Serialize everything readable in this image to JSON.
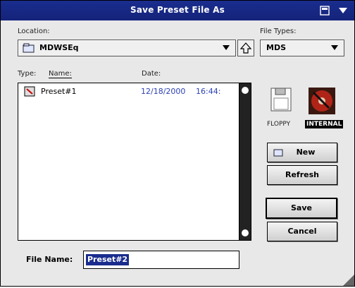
{
  "window": {
    "title": "Save Preset File As"
  },
  "location": {
    "label": "Location:",
    "value": "MDWSEq"
  },
  "file_types": {
    "label": "File Types:",
    "value": "MDS"
  },
  "list": {
    "type_label": "Type:",
    "name_label": "Name:",
    "date_label": "Date:",
    "rows": [
      {
        "name": "Preset#1",
        "date": "12/18/2000",
        "time": "16:44:"
      }
    ]
  },
  "drives": [
    {
      "label": "FLOPPY"
    },
    {
      "label": "INTERNAL"
    }
  ],
  "buttons": {
    "new": "New",
    "refresh": "Refresh",
    "save": "Save",
    "cancel": "Cancel"
  },
  "filename": {
    "label": "File Name:",
    "value": "Preset#2"
  },
  "colors": {
    "titlebar": "#1a2d8e",
    "date_text": "#2a3fb3"
  }
}
